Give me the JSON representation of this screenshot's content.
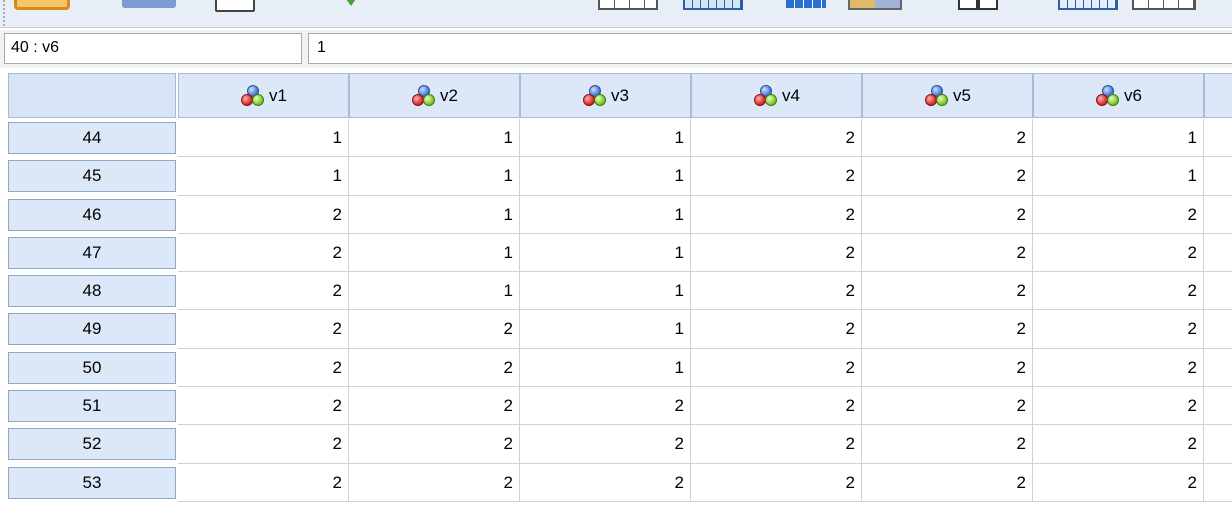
{
  "toolbar": {
    "icons": [
      "open-data-icon",
      "recall-dialog-icon",
      "print-icon",
      "insert-case-icon",
      "goto-case-icon",
      "goto-variable-icon",
      "variables-icon",
      "split-file-icon",
      "weight-cases-icon",
      "select-cases-icon",
      "value-labels-icon"
    ]
  },
  "cell_ref": {
    "location": "40 : v6",
    "value": "1"
  },
  "grid": {
    "columns": [
      "v1",
      "v2",
      "v3",
      "v4",
      "v5",
      "v6"
    ],
    "column_icon": "nominal-variable-icon",
    "rows": [
      {
        "case": "44",
        "values": [
          "1",
          "1",
          "1",
          "2",
          "2",
          "1"
        ]
      },
      {
        "case": "45",
        "values": [
          "1",
          "1",
          "1",
          "2",
          "2",
          "1"
        ]
      },
      {
        "case": "46",
        "values": [
          "2",
          "1",
          "1",
          "2",
          "2",
          "2"
        ]
      },
      {
        "case": "47",
        "values": [
          "2",
          "1",
          "1",
          "2",
          "2",
          "2"
        ]
      },
      {
        "case": "48",
        "values": [
          "2",
          "1",
          "1",
          "2",
          "2",
          "2"
        ]
      },
      {
        "case": "49",
        "values": [
          "2",
          "2",
          "1",
          "2",
          "2",
          "2"
        ]
      },
      {
        "case": "50",
        "values": [
          "2",
          "2",
          "1",
          "2",
          "2",
          "2"
        ]
      },
      {
        "case": "51",
        "values": [
          "2",
          "2",
          "2",
          "2",
          "2",
          "2"
        ]
      },
      {
        "case": "52",
        "values": [
          "2",
          "2",
          "2",
          "2",
          "2",
          "2"
        ]
      },
      {
        "case": "53",
        "values": [
          "2",
          "2",
          "2",
          "2",
          "2",
          "2"
        ]
      }
    ]
  }
}
